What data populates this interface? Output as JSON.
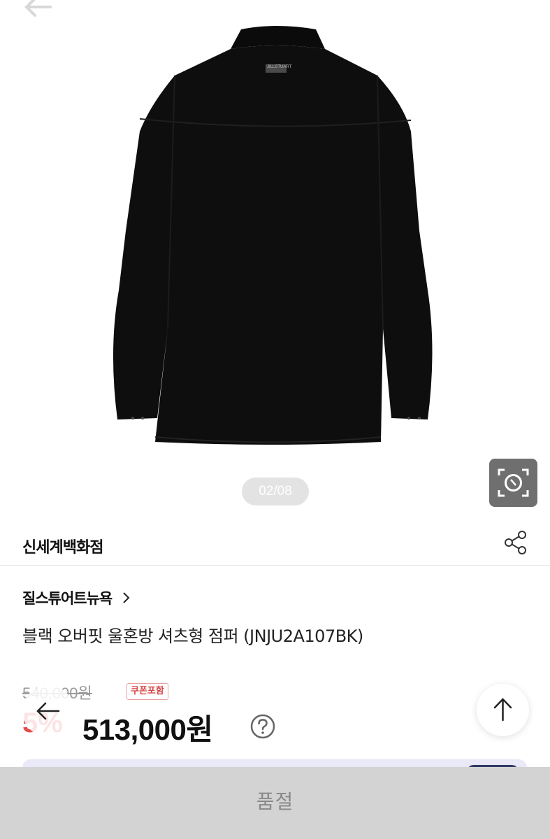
{
  "gallery": {
    "counter": "02/08",
    "brand_tag": "JILLSTUART"
  },
  "store": {
    "name": "신세계백화점"
  },
  "product": {
    "brand": "질스튜어트뉴욕",
    "title": "블랙 오버핏 울혼방 셔츠형 점퍼 (JNJU2A107BK)",
    "original_price": "540,000원",
    "coupon_badge": "쿠폰포함",
    "discount": "5%",
    "sale_price": "513,000원"
  },
  "bottom_bar": {
    "label": "품절"
  },
  "icons": {
    "back": "back-arrow-icon",
    "lens": "camera-lens-icon",
    "share": "share-icon",
    "help": "question-mark-icon",
    "prev": "left-arrow-icon",
    "to_top": "up-arrow-icon"
  },
  "colors": {
    "discount_red": "#e84a4a",
    "coupon_red": "#d64545",
    "soldout_bar": "#d3d3d3",
    "lens_button": "#6f6f6f"
  }
}
